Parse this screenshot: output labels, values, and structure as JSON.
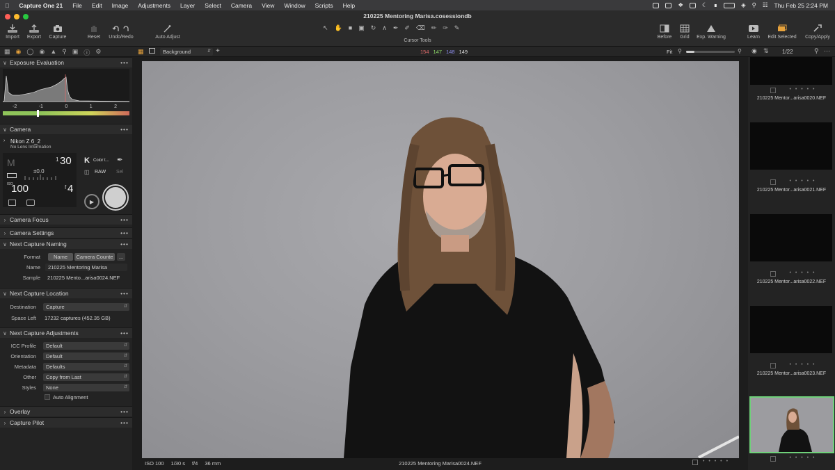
{
  "menubar": {
    "app": "Capture One 21",
    "items": [
      "File",
      "Edit",
      "Image",
      "Adjustments",
      "Layer",
      "Select",
      "Camera",
      "View",
      "Window",
      "Scripts",
      "Help"
    ],
    "clock": "Thu Feb 25  2:24 PM"
  },
  "window": {
    "title": "210225 Mentoring Marisa.cosessiondb"
  },
  "toolbar": {
    "import": "Import",
    "export": "Export",
    "capture": "Capture",
    "reset": "Reset",
    "undo_redo": "Undo/Redo",
    "auto_adjust": "Auto Adjust",
    "cursor_tools": "Cursor Tools",
    "before": "Before",
    "grid": "Grid",
    "exp_warning": "Exp. Warning",
    "learn": "Learn",
    "edit_selected": "Edit Selected",
    "copy_apply": "Copy/Apply"
  },
  "toolrow": {
    "layer": "Background",
    "rgb": {
      "r": "154",
      "g": "147",
      "b": "148",
      "a": "149"
    },
    "fit": "Fit",
    "count": "1/22"
  },
  "colors": {
    "accent": "#e8a33c",
    "selected_border": "#6fd17a",
    "red": "#e06a6a",
    "green": "#8fdc6a",
    "blue": "#8a8ae8"
  },
  "exposure": {
    "title": "Exposure Evaluation",
    "ticks": [
      "-2",
      "-1",
      "0",
      "1",
      "2"
    ]
  },
  "camera": {
    "title": "Camera",
    "model": "Nikon Z 6_2",
    "lens": "No Lens Information",
    "mode": "M",
    "shutter_num": "1",
    "shutter_den": "30",
    "ev": "±0.0",
    "iso_label": "ISO",
    "iso": "100",
    "aperture_f": "f",
    "aperture": "4",
    "wb_k": "K",
    "wb_label": "Color t...",
    "raw": "RAW",
    "sel": "Sel"
  },
  "sections": {
    "camera_focus": "Camera Focus",
    "camera_settings": "Camera Settings",
    "next_capture_naming": "Next Capture Naming",
    "next_capture_location": "Next Capture Location",
    "next_capture_adjustments": "Next Capture Adjustments",
    "overlay": "Overlay",
    "capture_pilot": "Capture Pilot"
  },
  "naming": {
    "format_label": "Format",
    "format_tokens": [
      "Name",
      "Camera Counte"
    ],
    "more": "...",
    "name_label": "Name",
    "name_value": "210225 Mentoring Marisa",
    "sample_label": "Sample",
    "sample_value": "210225 Mento...arisa0024.NEF"
  },
  "location": {
    "destination_label": "Destination",
    "destination_value": "Capture",
    "space_label": "Space Left",
    "space_value": "17232 captures (452.35 GB)"
  },
  "adjustments": {
    "icc_label": "ICC Profile",
    "icc_value": "Default",
    "orientation_label": "Orientation",
    "orientation_value": "Default",
    "metadata_label": "Metadata",
    "metadata_value": "Defaults",
    "other_label": "Other",
    "other_value": "Copy from Last",
    "styles_label": "Styles",
    "styles_value": "None",
    "auto_alignment": "Auto Alignment"
  },
  "viewer_footer": {
    "iso": "ISO 100",
    "shutter": "1/30 s",
    "aperture": "f/4",
    "focal": "36 mm",
    "filename": "210225 Mentoring Marisa0024.NEF"
  },
  "filmstrip": [
    {
      "name": "210225 Mentor...arisa0020.NEF",
      "rating": "• • • • •"
    },
    {
      "name": "210225 Mentor...arisa0021.NEF",
      "rating": "• • • • •"
    },
    {
      "name": "210225 Mentor...arisa0022.NEF",
      "rating": "• • • • •"
    },
    {
      "name": "210225 Mentor...arisa0023.NEF",
      "rating": "• • • • •"
    },
    {
      "name": "",
      "rating": "• • • • •"
    }
  ]
}
